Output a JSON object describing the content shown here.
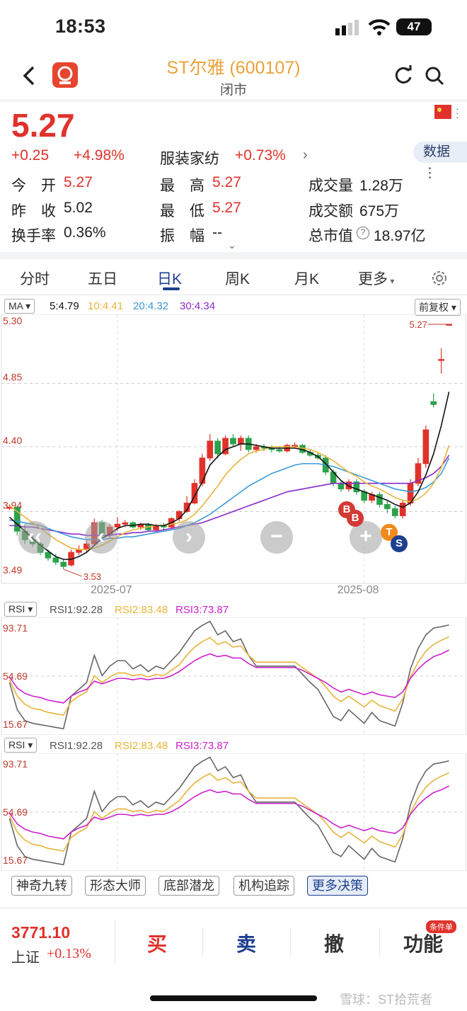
{
  "status_bar": {
    "time": "18:53",
    "battery": "47"
  },
  "header": {
    "title": "ST尔雅 (600107)",
    "subtitle": "闭市"
  },
  "quote": {
    "price": "5.27",
    "change": "+0.25",
    "change_pct": "+4.98%",
    "sector": "服装家纺",
    "sector_pct": "+0.73%",
    "data_button": "数据",
    "open_label": "今　开",
    "open": "5.27",
    "high_label": "最　高",
    "high": "5.27",
    "volume_label": "成交量",
    "volume": "1.28万",
    "prev_close_label": "昨　收",
    "prev_close": "5.02",
    "low_label": "最　低",
    "low": "5.27",
    "amount_label": "成交额",
    "amount": "675万",
    "turnover_label": "换手率",
    "turnover": "0.36%",
    "amplitude_label": "振　幅",
    "amplitude": "--",
    "mcap_label": "总市值",
    "mcap": "18.97亿"
  },
  "tabs": [
    "分时",
    "五日",
    "日K",
    "周K",
    "月K",
    "更多"
  ],
  "ma_bar": {
    "select": "MA",
    "ma5": "5:4.79",
    "ma10": "10:4.41",
    "ma20": "20:4.32",
    "ma30": "30:4.34",
    "adjust": "前复权"
  },
  "rsi_bar": {
    "select": "RSI",
    "rsi1": "RSI1:92.28",
    "rsi2": "RSI2:83.48",
    "rsi3": "RSI3:73.87"
  },
  "features": [
    "神奇九转",
    "形态大师",
    "底部潜龙",
    "机构追踪",
    "更多决策"
  ],
  "index": {
    "value": "3771.10",
    "name": "上证",
    "pct": "+0.13%"
  },
  "actions": {
    "buy": "买",
    "sell": "卖",
    "cancel": "撤",
    "func": "功能",
    "badge": "条件单"
  },
  "watermark": "雪球：ST拾荒者",
  "colors": {
    "up": "#e0322b",
    "down": "#2ba14b",
    "ma5": "#111111",
    "ma10": "#e7b43a",
    "ma20": "#3a9ad9",
    "ma30": "#8a2bc8"
  },
  "chart_data": {
    "type": "candlestick",
    "y_ticks": [
      "5.30",
      "4.85",
      "4.40",
      "3.94",
      "3.49"
    ],
    "ylim": [
      3.49,
      5.3
    ],
    "x_ticks": [
      "2025-07",
      "2025-08"
    ],
    "max_label": "5.27",
    "min_label": "3.53",
    "candles": [
      [
        3.97,
        3.99,
        3.95,
        3.97
      ],
      [
        3.97,
        3.97,
        3.77,
        3.8
      ],
      [
        3.8,
        3.85,
        3.71,
        3.74
      ],
      [
        3.74,
        3.77,
        3.69,
        3.71
      ],
      [
        3.71,
        3.73,
        3.63,
        3.65
      ],
      [
        3.65,
        3.67,
        3.59,
        3.61
      ],
      [
        3.61,
        3.64,
        3.56,
        3.58
      ],
      [
        3.58,
        3.6,
        3.53,
        3.55
      ],
      [
        3.56,
        3.67,
        3.55,
        3.65
      ],
      [
        3.65,
        3.7,
        3.63,
        3.67
      ],
      [
        3.67,
        3.73,
        3.65,
        3.71
      ],
      [
        3.71,
        3.89,
        3.7,
        3.86
      ],
      [
        3.86,
        3.88,
        3.76,
        3.78
      ],
      [
        3.78,
        3.85,
        3.75,
        3.83
      ],
      [
        3.83,
        3.9,
        3.8,
        3.85
      ],
      [
        3.85,
        3.88,
        3.83,
        3.86
      ],
      [
        3.86,
        3.87,
        3.82,
        3.83
      ],
      [
        3.83,
        3.86,
        3.81,
        3.85
      ],
      [
        3.85,
        3.86,
        3.8,
        3.81
      ],
      [
        3.81,
        3.85,
        3.8,
        3.84
      ],
      [
        3.84,
        3.86,
        3.81,
        3.83
      ],
      [
        3.83,
        3.9,
        3.82,
        3.89
      ],
      [
        3.89,
        3.95,
        3.87,
        3.94
      ],
      [
        3.94,
        4.05,
        3.93,
        4.0
      ],
      [
        4.0,
        4.17,
        3.99,
        4.14
      ],
      [
        4.14,
        4.35,
        4.12,
        4.32
      ],
      [
        4.32,
        4.49,
        4.3,
        4.44
      ],
      [
        4.44,
        4.46,
        4.32,
        4.35
      ],
      [
        4.35,
        4.48,
        4.34,
        4.46
      ],
      [
        4.46,
        4.49,
        4.4,
        4.42
      ],
      [
        4.42,
        4.48,
        4.37,
        4.46
      ],
      [
        4.46,
        4.48,
        4.36,
        4.38
      ],
      [
        4.38,
        4.42,
        4.36,
        4.4
      ],
      [
        4.4,
        4.42,
        4.37,
        4.39
      ],
      [
        4.39,
        4.41,
        4.36,
        4.38
      ],
      [
        4.38,
        4.4,
        4.36,
        4.37
      ],
      [
        4.37,
        4.42,
        4.36,
        4.41
      ],
      [
        4.41,
        4.43,
        4.39,
        4.41
      ],
      [
        4.41,
        4.42,
        4.35,
        4.36
      ],
      [
        4.36,
        4.38,
        4.33,
        4.34
      ],
      [
        4.34,
        4.36,
        4.31,
        4.32
      ],
      [
        4.32,
        4.34,
        4.2,
        4.22
      ],
      [
        4.22,
        4.24,
        4.12,
        4.14
      ],
      [
        4.14,
        4.16,
        4.08,
        4.1
      ],
      [
        4.1,
        4.17,
        4.08,
        4.15
      ],
      [
        4.15,
        4.17,
        4.06,
        4.08
      ],
      [
        4.08,
        4.1,
        4.0,
        4.02
      ],
      [
        4.02,
        4.08,
        4.0,
        4.06
      ],
      [
        4.06,
        4.08,
        3.97,
        3.99
      ],
      [
        3.99,
        4.02,
        3.93,
        3.96
      ],
      [
        3.96,
        3.98,
        3.89,
        3.91
      ],
      [
        3.91,
        4.02,
        3.89,
        4.0
      ],
      [
        4.0,
        4.17,
        3.98,
        4.14
      ],
      [
        4.14,
        4.32,
        4.12,
        4.28
      ],
      [
        4.28,
        4.55,
        4.25,
        4.52
      ],
      [
        4.72,
        4.78,
        4.68,
        4.7
      ],
      [
        5.02,
        5.1,
        4.92,
        5.02
      ],
      [
        5.27,
        5.27,
        5.27,
        5.27
      ]
    ],
    "ma5": [
      3.9,
      3.85,
      3.8,
      3.75,
      3.7,
      3.66,
      3.62,
      3.6,
      3.6,
      3.62,
      3.65,
      3.7,
      3.75,
      3.78,
      3.82,
      3.84,
      3.84,
      3.85,
      3.85,
      3.84,
      3.84,
      3.86,
      3.89,
      3.95,
      4.05,
      4.15,
      4.27,
      4.33,
      4.38,
      4.4,
      4.42,
      4.42,
      4.41,
      4.4,
      4.39,
      4.39,
      4.39,
      4.39,
      4.38,
      4.36,
      4.33,
      4.28,
      4.22,
      4.16,
      4.12,
      4.1,
      4.08,
      4.06,
      4.04,
      4.02,
      3.99,
      3.97,
      4.0,
      4.08,
      4.2,
      4.35,
      4.55,
      4.79
    ],
    "ma10": [
      3.98,
      3.94,
      3.9,
      3.86,
      3.82,
      3.78,
      3.74,
      3.71,
      3.68,
      3.67,
      3.67,
      3.68,
      3.7,
      3.73,
      3.76,
      3.79,
      3.81,
      3.82,
      3.83,
      3.84,
      3.84,
      3.85,
      3.86,
      3.88,
      3.92,
      3.98,
      4.05,
      4.12,
      4.2,
      4.26,
      4.31,
      4.35,
      4.37,
      4.38,
      4.4,
      4.4,
      4.4,
      4.4,
      4.39,
      4.38,
      4.36,
      4.33,
      4.3,
      4.26,
      4.22,
      4.19,
      4.15,
      4.12,
      4.1,
      4.07,
      4.04,
      4.02,
      4.01,
      4.03,
      4.07,
      4.14,
      4.25,
      4.41
    ],
    "ma20": [
      3.88,
      3.87,
      3.86,
      3.85,
      3.84,
      3.82,
      3.8,
      3.78,
      3.76,
      3.75,
      3.74,
      3.74,
      3.74,
      3.75,
      3.75,
      3.76,
      3.76,
      3.77,
      3.78,
      3.79,
      3.8,
      3.81,
      3.82,
      3.84,
      3.86,
      3.89,
      3.92,
      3.96,
      4.0,
      4.04,
      4.08,
      4.12,
      4.15,
      4.18,
      4.21,
      4.23,
      4.25,
      4.27,
      4.28,
      4.28,
      4.28,
      4.27,
      4.26,
      4.24,
      4.22,
      4.2,
      4.18,
      4.16,
      4.14,
      4.12,
      4.1,
      4.09,
      4.08,
      4.09,
      4.11,
      4.15,
      4.21,
      4.32
    ],
    "ma30": [
      3.84,
      3.84,
      3.83,
      3.83,
      3.82,
      3.81,
      3.8,
      3.79,
      3.78,
      3.78,
      3.77,
      3.77,
      3.77,
      3.77,
      3.78,
      3.78,
      3.79,
      3.79,
      3.8,
      3.8,
      3.81,
      3.82,
      3.83,
      3.84,
      3.85,
      3.86,
      3.88,
      3.9,
      3.92,
      3.94,
      3.96,
      3.98,
      4.0,
      4.02,
      4.04,
      4.06,
      4.08,
      4.09,
      4.1,
      4.11,
      4.12,
      4.13,
      4.14,
      4.14,
      4.14,
      4.14,
      4.14,
      4.14,
      4.14,
      4.14,
      4.14,
      4.14,
      4.14,
      4.16,
      4.18,
      4.21,
      4.26,
      4.34
    ],
    "rsi_y_ticks": [
      "93.71",
      "54.69",
      "15.67"
    ],
    "rsi_ylim": [
      15.67,
      93.71
    ],
    "rsi1": [
      50,
      30,
      22,
      20,
      19,
      18,
      17,
      16,
      40,
      45,
      50,
      70,
      55,
      62,
      66,
      66,
      60,
      63,
      58,
      62,
      60,
      66,
      72,
      80,
      88,
      92,
      95,
      85,
      88,
      80,
      82,
      70,
      62,
      62,
      62,
      62,
      62,
      62,
      56,
      50,
      45,
      35,
      25,
      22,
      30,
      25,
      20,
      28,
      22,
      20,
      18,
      35,
      60,
      75,
      85,
      90,
      91,
      92.28
    ],
    "rsi2": [
      52,
      40,
      34,
      31,
      30,
      28,
      27,
      26,
      36,
      40,
      43,
      55,
      50,
      54,
      57,
      57,
      55,
      56,
      54,
      56,
      55,
      59,
      63,
      70,
      76,
      80,
      83,
      78,
      80,
      76,
      77,
      70,
      65,
      65,
      65,
      65,
      65,
      65,
      61,
      57,
      53,
      47,
      40,
      36,
      40,
      36,
      32,
      37,
      33,
      31,
      29,
      38,
      54,
      65,
      73,
      78,
      81,
      83.48
    ],
    "rsi3": [
      54,
      46,
      42,
      40,
      39,
      37,
      36,
      35,
      40,
      43,
      45,
      51,
      49,
      51,
      53,
      53,
      52,
      53,
      52,
      53,
      53,
      55,
      58,
      62,
      66,
      69,
      71,
      69,
      70,
      68,
      68,
      64,
      61,
      61,
      61,
      61,
      61,
      61,
      59,
      56,
      53,
      50,
      46,
      43,
      45,
      43,
      41,
      43,
      41,
      40,
      39,
      43,
      53,
      60,
      65,
      69,
      71,
      73.87
    ],
    "markers": [
      "B",
      "B",
      "T",
      "S"
    ]
  }
}
